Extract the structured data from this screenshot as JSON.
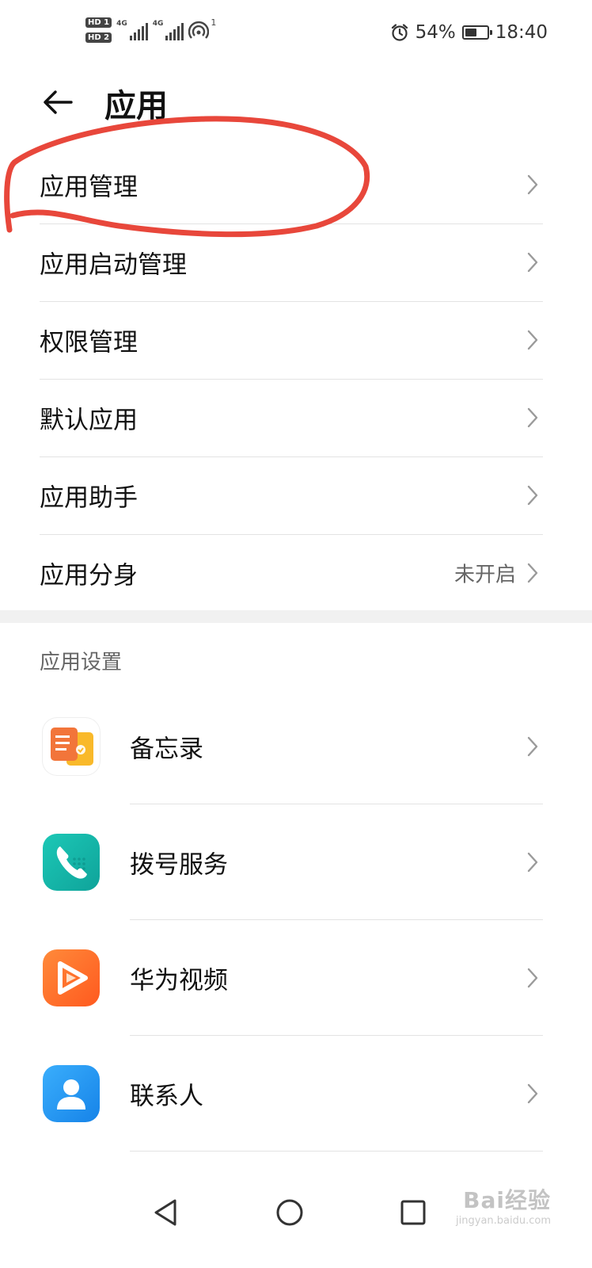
{
  "status_bar": {
    "hd_labels": [
      "HD 1",
      "HD 2"
    ],
    "signal_labels": [
      "4G",
      "4G"
    ],
    "hotspot_count": "1",
    "battery": "54%",
    "battery_level": 0.54,
    "time": "18:40"
  },
  "header": {
    "title": "应用"
  },
  "menu": [
    {
      "label": "应用管理",
      "value": ""
    },
    {
      "label": "应用启动管理",
      "value": ""
    },
    {
      "label": "权限管理",
      "value": ""
    },
    {
      "label": "默认应用",
      "value": ""
    },
    {
      "label": "应用助手",
      "value": ""
    },
    {
      "label": "应用分身",
      "value": "未开启"
    }
  ],
  "section": {
    "title": "应用设置"
  },
  "apps": [
    {
      "label": "备忘录",
      "icon": "memo-icon",
      "color": "#f7a21b"
    },
    {
      "label": "拨号服务",
      "icon": "phone-icon",
      "color": "#14b3a8"
    },
    {
      "label": "华为视频",
      "icon": "video-icon",
      "color": "#ff6d2d"
    },
    {
      "label": "联系人",
      "icon": "contacts-icon",
      "color": "#1e96f0"
    }
  ],
  "annotation_color": "#e8473b",
  "watermark": {
    "main": "Bai经验",
    "sub": "jingyan.baidu.com"
  }
}
